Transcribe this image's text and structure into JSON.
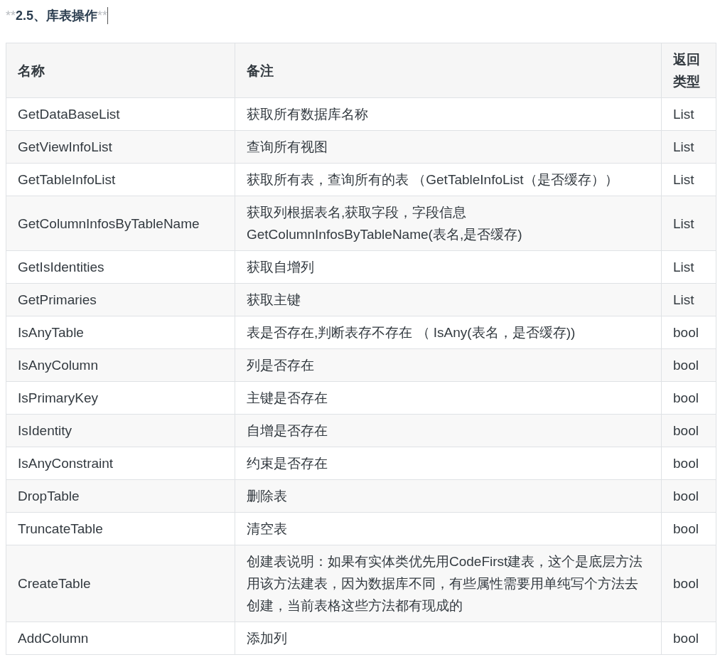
{
  "heading": {
    "marker_open": "**",
    "text": "2.5、库表操作",
    "marker_close": "**"
  },
  "table": {
    "columns": [
      "名称",
      "备注",
      "返回类型"
    ],
    "rows": [
      [
        "GetDataBaseList",
        "获取所有数据库名称",
        "List"
      ],
      [
        "GetViewInfoList",
        "查询所有视图",
        "List"
      ],
      [
        "GetTableInfoList",
        "获取所有表，查询所有的表 （GetTableInfoList（是否缓存））",
        "List"
      ],
      [
        "GetColumnInfosByTableName",
        "获取列根据表名,获取字段，字段信息 GetColumnInfosByTableName(表名,是否缓存)",
        "List"
      ],
      [
        "GetIsIdentities",
        "获取自增列",
        "List"
      ],
      [
        "GetPrimaries",
        "获取主键",
        "List"
      ],
      [
        "IsAnyTable",
        "表是否存在,判断表存不存在 （ IsAny(表名，是否缓存))",
        "bool"
      ],
      [
        "IsAnyColumn",
        "列是否存在",
        "bool"
      ],
      [
        "IsPrimaryKey",
        "主键是否存在",
        "bool"
      ],
      [
        "IsIdentity",
        "自增是否存在",
        "bool"
      ],
      [
        "IsAnyConstraint",
        "约束是否存在",
        "bool"
      ],
      [
        "DropTable",
        "删除表",
        "bool"
      ],
      [
        "TruncateTable",
        "清空表",
        "bool"
      ],
      [
        "CreateTable",
        "创建表说明：如果有实体类优先用CodeFirst建表，这个是底层方法用该方法建表，因为数据库不同，有些属性需要用单纯写个方法去创建，当前表格这些方法都有现成的",
        "bool"
      ],
      [
        "AddColumn",
        "添加列",
        "bool"
      ]
    ]
  }
}
